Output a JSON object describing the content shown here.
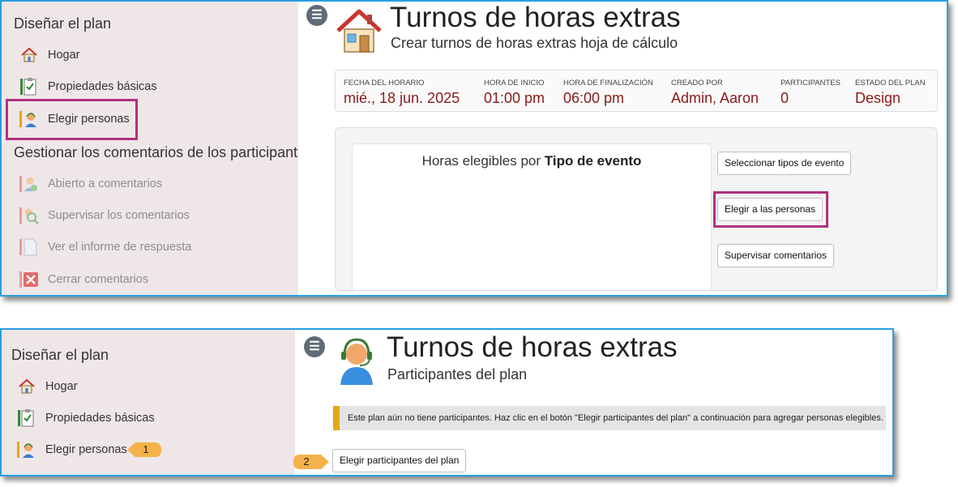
{
  "colors": {
    "frame_border": "#2a9de0",
    "sidebar_bg": "#efe7e7",
    "highlight": "#b1307f",
    "value_text": "#8a1a1a",
    "notice_accent": "#e3a812",
    "callout": "#f5b24a"
  },
  "screen1": {
    "sidebar": {
      "section1_title": "Diseñar el plan",
      "items1": [
        {
          "label": "Hogar",
          "icon": "home-icon"
        },
        {
          "label": "Propiedades básicas",
          "icon": "checklist-icon"
        },
        {
          "label": "Elegir personas",
          "icon": "person-headset-icon"
        }
      ],
      "section2_title": "Gestionar los comentarios de los participantes",
      "items2": [
        {
          "label": "Abierto a comentarios",
          "icon": "open-comments-icon"
        },
        {
          "label": "Supervisar los comentarios",
          "icon": "monitor-comments-icon"
        },
        {
          "label": "Ver el informe de respuesta",
          "icon": "report-icon"
        },
        {
          "label": "Cerrar comentarios",
          "icon": "close-comments-icon"
        }
      ]
    },
    "header": {
      "title": "Turnos de horas extras",
      "subtitle": "Crear turnos de horas extras hoja de cálculo",
      "icon": "house-icon"
    },
    "info": [
      {
        "label": "FECHA DEL HORARIO",
        "value": "mié., 18 jun. 2025"
      },
      {
        "label": "HORA DE INICIO",
        "value": "01:00 pm"
      },
      {
        "label": "HORA DE FINALIZACIÓN",
        "value": "06:00 pm"
      },
      {
        "label": "CREADO POR",
        "value": "Admin, Aaron"
      },
      {
        "label": "PARTICIPANTES",
        "value": "0"
      },
      {
        "label": "ESTADO DEL PLAN",
        "value": "Design"
      }
    ],
    "chart": {
      "title_prefix": "Horas elegibles por ",
      "title_bold": "Tipo de evento"
    },
    "buttons": {
      "select_event_types": "Seleccionar tipos de evento",
      "choose_people": "Elegir a las personas",
      "monitor_comments": "Supervisar comentarios"
    }
  },
  "screen2": {
    "sidebar": {
      "section1_title": "Diseñar el plan",
      "items1": [
        {
          "label": "Hogar",
          "icon": "home-icon"
        },
        {
          "label": "Propiedades básicas",
          "icon": "checklist-icon"
        },
        {
          "label": "Elegir personas",
          "icon": "person-headset-icon"
        }
      ]
    },
    "header": {
      "title": "Turnos de horas extras",
      "subtitle": "Participantes del plan",
      "icon": "person-headset-icon"
    },
    "notice": "Este plan aún no tiene participantes. Haz clic en el botón \"Elegir participantes del plan\" a continuación para agregar personas elegibles.",
    "button_choose_participants": "Elegir participantes del plan",
    "callouts": [
      "1",
      "2"
    ]
  }
}
